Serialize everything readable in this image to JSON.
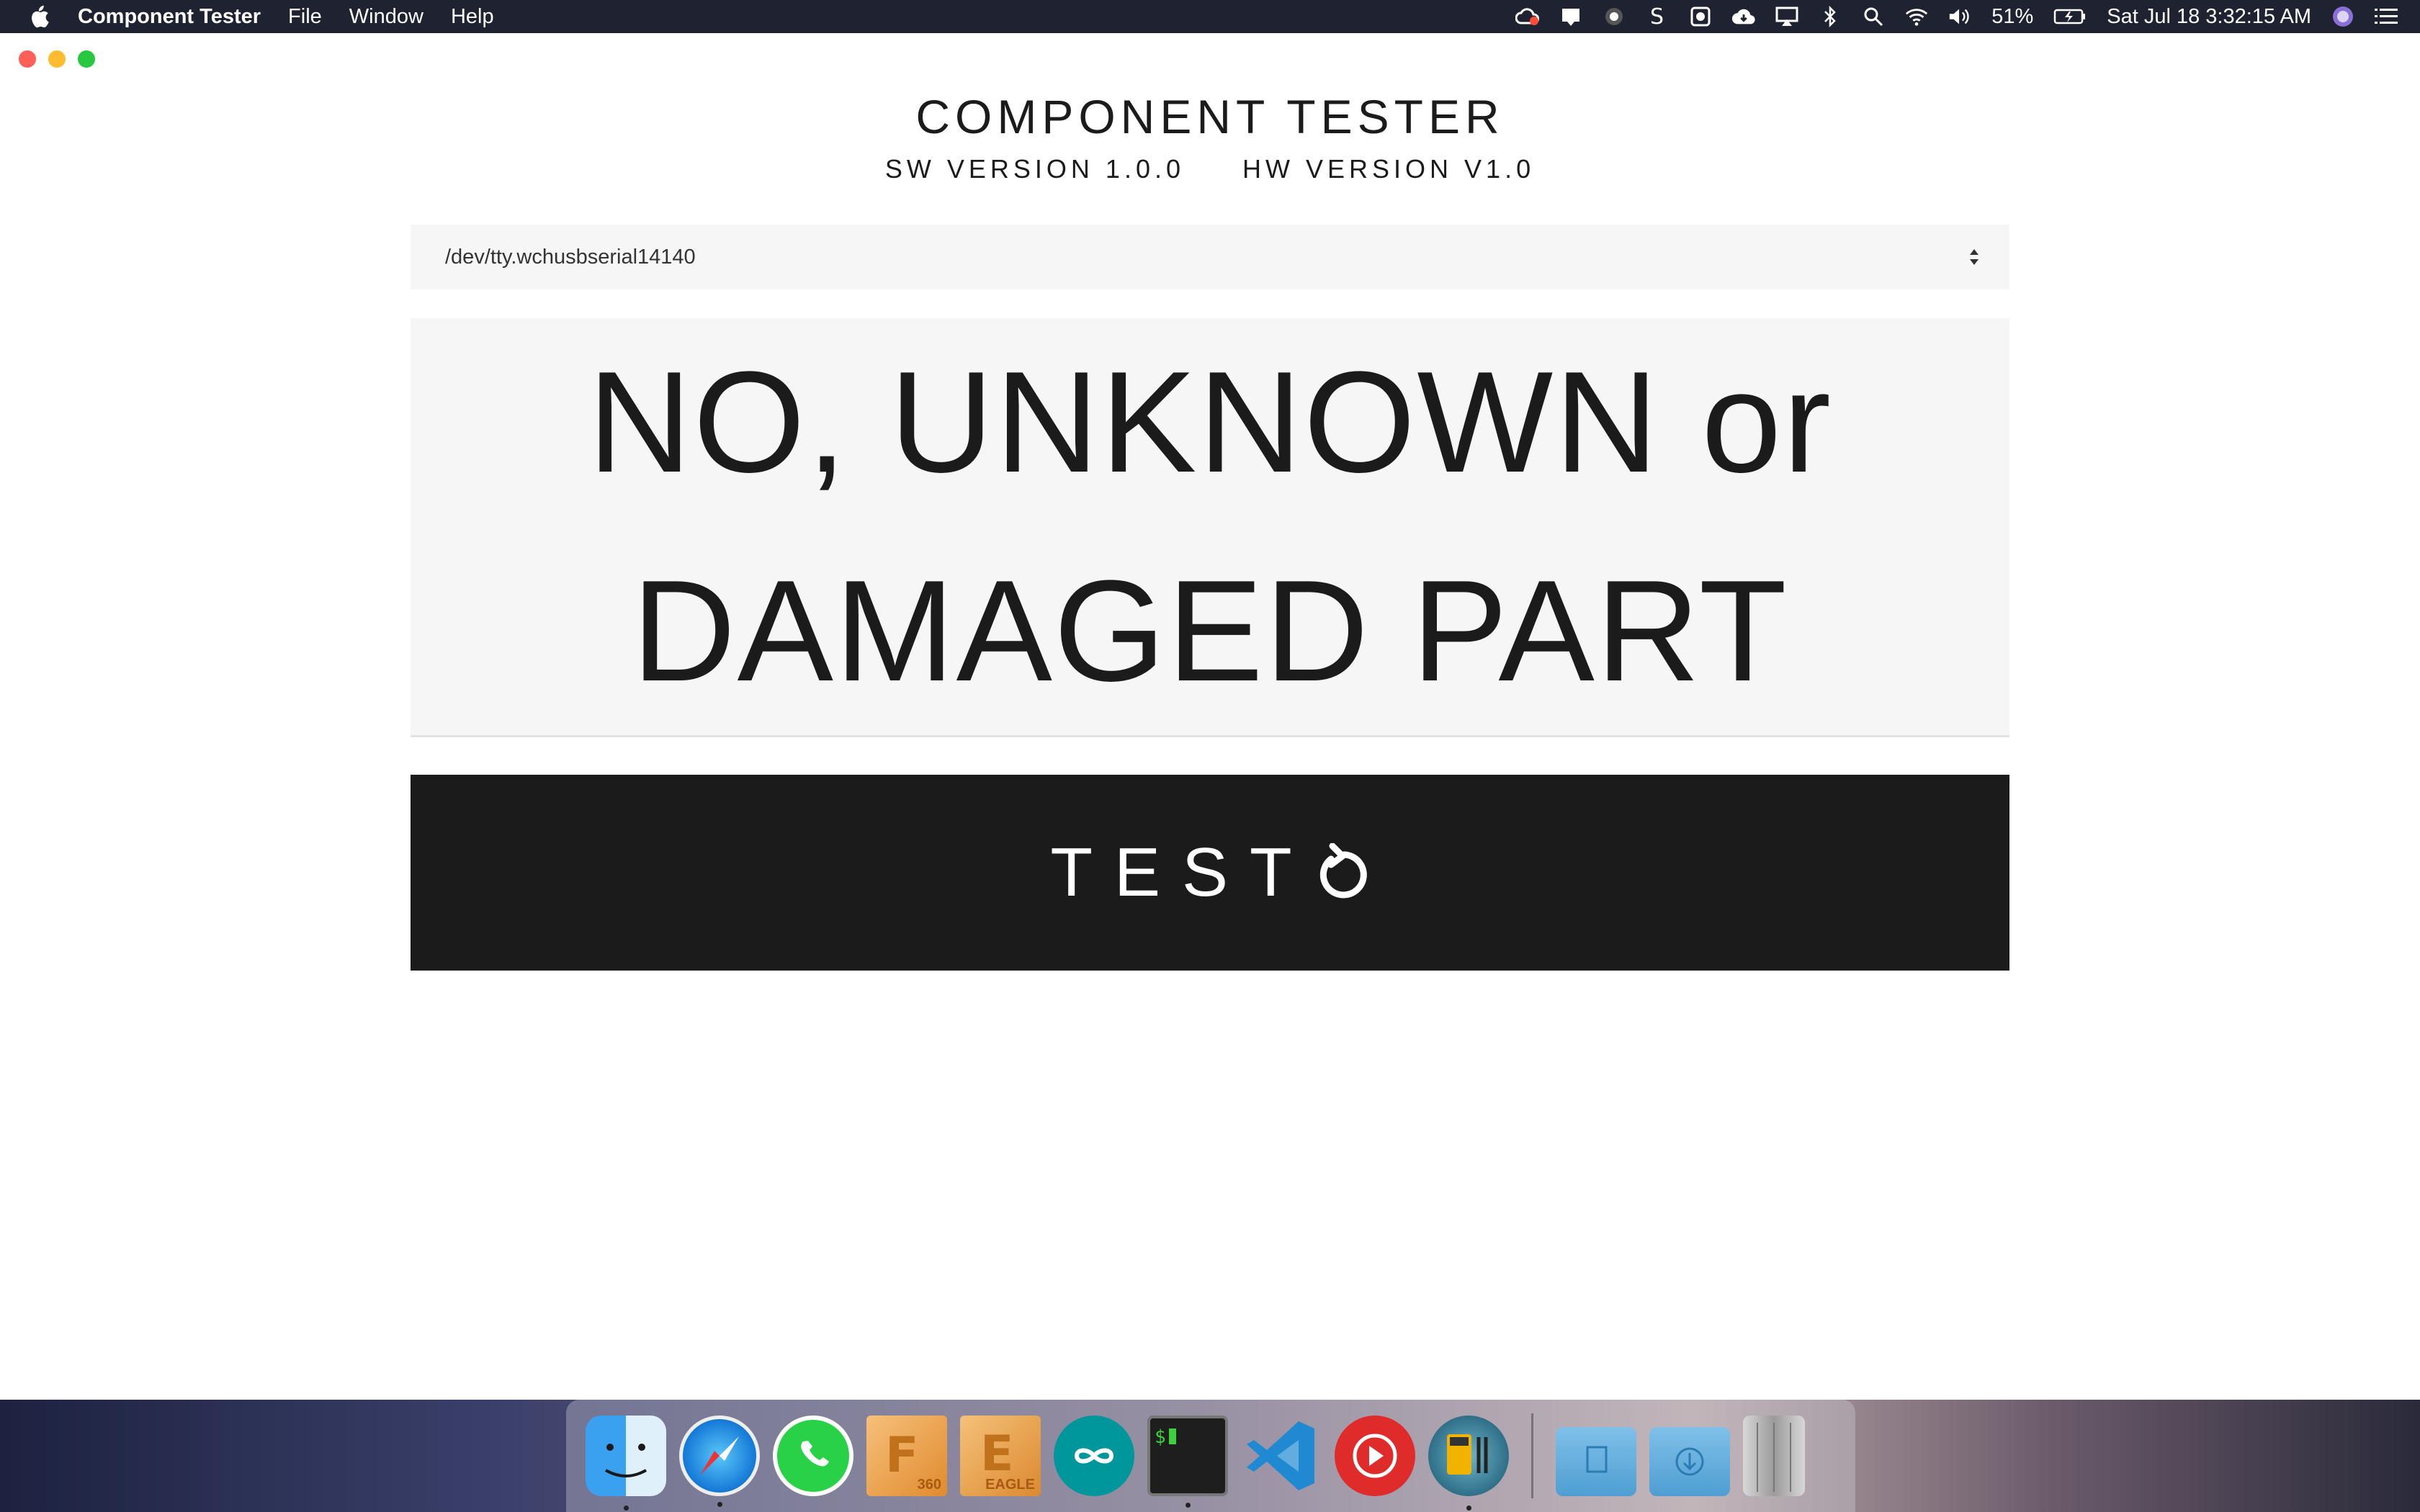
{
  "menubar": {
    "app_name": "Component Tester",
    "menus": [
      "File",
      "Window",
      "Help"
    ],
    "status": {
      "battery": "51%",
      "datetime": "Sat Jul 18  3:32:15 AM"
    },
    "icons": [
      "creative-cloud-icon",
      "notification-icon",
      "app-icon",
      "s-icon",
      "settings-icon",
      "cloud-icon",
      "airplay-icon",
      "bluetooth-icon",
      "search-icon",
      "wifi-icon",
      "volume-icon",
      "battery-icon",
      "siri-icon",
      "control-center-icon"
    ]
  },
  "app": {
    "title": "COMPONENT TESTER",
    "sw_version": "SW VERSION 1.0.0",
    "hw_version": "HW VERSION V1.0",
    "port": {
      "selected": "/dev/tty.wchusbserial14140"
    },
    "result": {
      "line1": "NO, UNKNOWN or",
      "line2": "DAMAGED PART"
    },
    "test_button": {
      "label": "TEST"
    }
  },
  "dock": {
    "apps": [
      "Finder",
      "Safari",
      "WhatsApp",
      "Fusion 360",
      "EAGLE",
      "Arduino",
      "Terminal",
      "Visual Studio Code",
      "YouTube",
      "Multimeter",
      "Documents",
      "Downloads",
      "Trash"
    ],
    "fusion_badge": "360",
    "eagle_badge": "EAGLE"
  },
  "colors": {
    "menubar_bg": "#1f2331",
    "panel_bg": "#f6f6f7",
    "button_bg": "#1b1b1b",
    "text": "#1b1b1b"
  }
}
